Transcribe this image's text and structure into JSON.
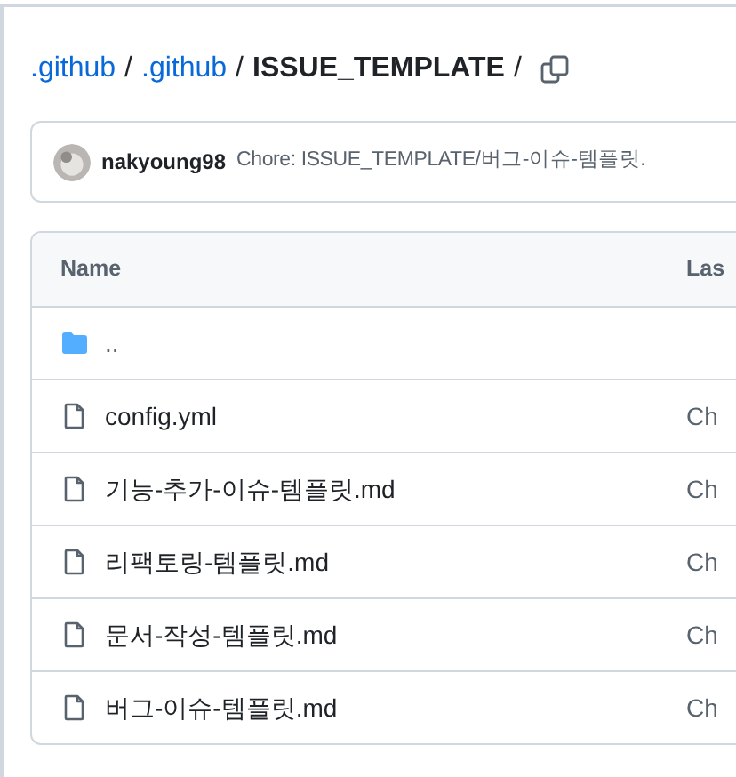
{
  "breadcrumb": [
    {
      "label": ".github",
      "kind": "link"
    },
    {
      "label": ".github",
      "kind": "link"
    },
    {
      "label": "ISSUE_TEMPLATE",
      "kind": "current"
    }
  ],
  "separator": "/",
  "commit": {
    "author": "nakyoung98",
    "message": "Chore: ISSUE_TEMPLATE/버그-이슈-템플릿."
  },
  "table": {
    "columns": [
      "Name",
      "Las"
    ],
    "rows": [
      {
        "kind": "folder",
        "name": "..",
        "column_2": ""
      },
      {
        "kind": "file",
        "name": "config.yml",
        "column_2": "Ch"
      },
      {
        "kind": "file",
        "name": "기능-추가-이슈-템플릿.md",
        "column_2": "Ch"
      },
      {
        "kind": "file",
        "name": "리팩토링-템플릿.md",
        "column_2": "Ch"
      },
      {
        "kind": "file",
        "name": "문서-작성-템플릿.md",
        "column_2": "Ch"
      },
      {
        "kind": "file",
        "name": "버그-이슈-템플릿.md",
        "column_2": "Ch"
      }
    ]
  }
}
